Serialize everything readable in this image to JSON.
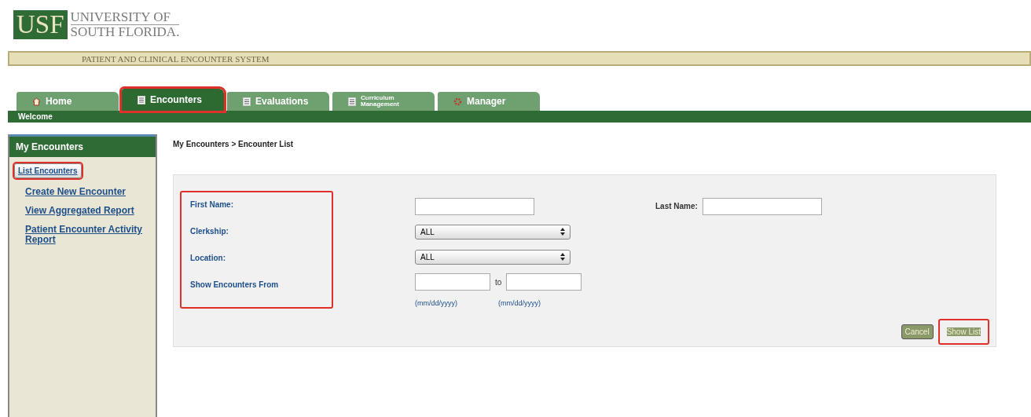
{
  "logo": {
    "mark": "USF",
    "line1": "UNIVERSITY OF",
    "line2": "SOUTH FLORIDA."
  },
  "system_title": "PATIENT AND CLINICAL ENCOUNTER SYSTEM",
  "tabs": [
    {
      "label": "Home",
      "kind": "home",
      "selected": false,
      "highlighted": false
    },
    {
      "label": "Encounters",
      "kind": "page",
      "selected": true,
      "highlighted": true
    },
    {
      "label": "Evaluations",
      "kind": "page",
      "selected": false,
      "highlighted": false
    },
    {
      "label": "Curriculum Management",
      "kind": "page-small",
      "selected": false,
      "highlighted": false
    },
    {
      "label": "Manager",
      "kind": "manager",
      "selected": false,
      "highlighted": false
    }
  ],
  "subnav": "Welcome",
  "sidebar": {
    "title": "My Encounters",
    "items": [
      {
        "label": "List Encounters",
        "selected": true,
        "highlighted": true
      },
      {
        "label": "Create New Encounter",
        "selected": false,
        "highlighted": false
      },
      {
        "label": "View Aggregated Report",
        "selected": false,
        "highlighted": false
      },
      {
        "label": "Patient Encounter Activity Report",
        "selected": false,
        "highlighted": false
      }
    ]
  },
  "breadcrumb": "My Encounters > Encounter List",
  "form": {
    "labels_highlighted": true,
    "first_name_label": "First Name:",
    "last_name_label": "Last Name:",
    "clerkship_label": "Clerkship:",
    "clerkship_value": "ALL",
    "location_label": "Location:",
    "location_value": "ALL",
    "show_from_label": "Show Encounters From",
    "to_label": "to",
    "date_hint_from": "(mm/dd/yyyy)",
    "date_hint_to": "(mm/dd/yyyy)"
  },
  "buttons": [
    {
      "label": "Cancel",
      "highlighted": false
    },
    {
      "label": "Show List",
      "highlighted": true
    }
  ]
}
